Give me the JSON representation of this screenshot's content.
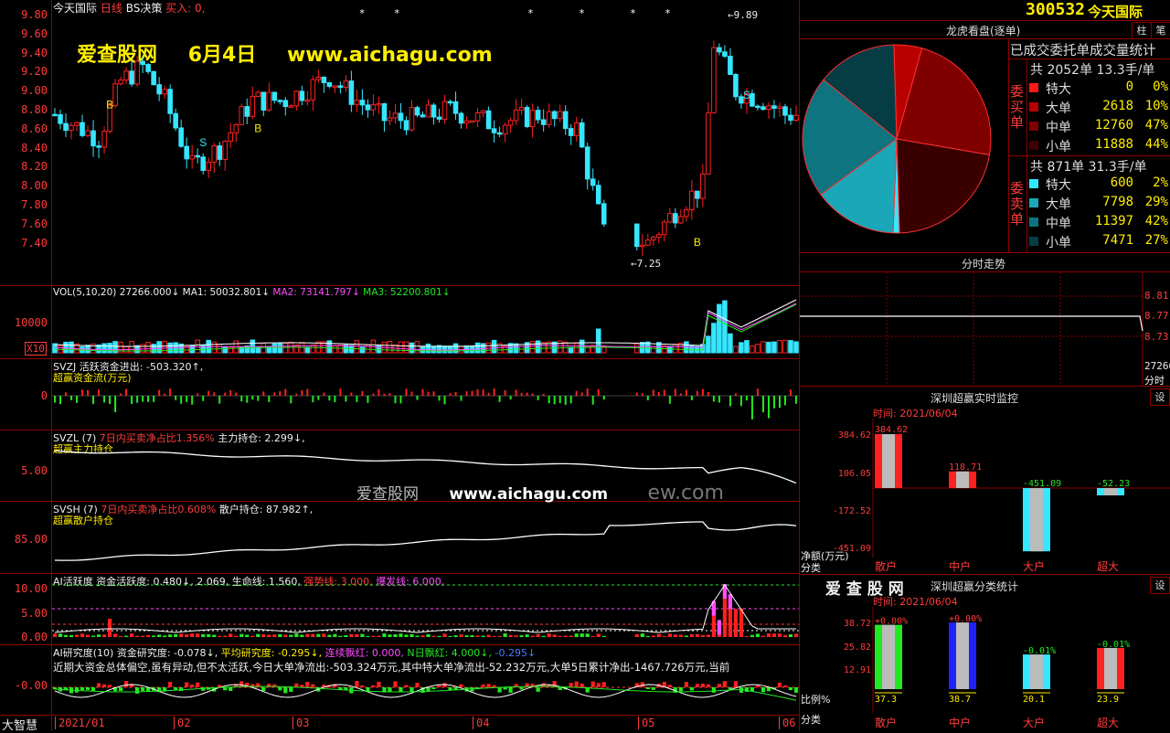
{
  "stock": {
    "code": "300532",
    "name": "今天国际",
    "period": "日线",
    "strategy": "BS决策",
    "buy_label": "买入: 0,"
  },
  "watermark": {
    "site": "爱查股网",
    "date": "6月4日",
    "url": "www.aichagu.com",
    "mid_site": "爱查股网",
    "mid_url": "www.aichagu.com",
    "mid_tail": "ew.com",
    "bottom_logo": "爱 查 股 网"
  },
  "price_axis": [
    "9.80",
    "9.60",
    "9.40",
    "9.20",
    "9.00",
    "8.80",
    "8.60",
    "8.40",
    "8.20",
    "8.00",
    "7.80",
    "7.60",
    "7.40"
  ],
  "price_marks": {
    "high": "9.89",
    "low": "7.25"
  },
  "bs_signals": {
    "b": "B",
    "s": "S"
  },
  "vol": {
    "header_name": "VOL(5,10,20)",
    "value": "27266.000↓",
    "ma1": "MA1: 50032.801↓",
    "ma2": "MA2: 73141.797↓",
    "ma3": "MA3: 52200.801↓",
    "axis": "10000",
    "x10": "X10"
  },
  "svzj": {
    "name": "SVZJ",
    "label": "活跃资金进出:",
    "value": "-503.320↑,",
    "sub": "超赢资金流(万元)",
    "axis": "0"
  },
  "svzl": {
    "name": "SVZL",
    "param": "(7)",
    "label": "7日内买卖净占比1.356%",
    "main_label": "主力持仓:",
    "main_value": "2.299↓,",
    "sub": "超赢主力持仓",
    "axis": "5.00"
  },
  "svsh": {
    "name": "SVSH",
    "param": "(7)",
    "label": "7日内买卖净占比0.608%",
    "main_label": "散户持仓:",
    "main_value": "87.982↑,",
    "sub": "超赢散户持仓",
    "axis": "85.00"
  },
  "ai_active": {
    "name": "AI活跃度",
    "a": "资金活跃度: 0.480↓,",
    "b": "2.069,",
    "c": "生命线: 1.560,",
    "d": "强势线: 3.000,",
    "e": "爆发线: 6.000,",
    "axis": [
      "10.00",
      "5.00",
      "0.00"
    ]
  },
  "ai_research": {
    "name": "AI研究度(10)",
    "a": "资金研究度: -0.078↓,",
    "b": "平均研究度: -0.295↓,",
    "c": "连续飘红: 0.000,",
    "d": "N日飘红: 4.000↓,",
    "e": "-0.295↓",
    "text": "近期大资金总体偏空,虽有异动,但不太活跃,今日大单净流出:-503.324万元,其中特大单净流出-52.232万元,大单5日累计净出-1467.726万元,当前",
    "axis": "-0.00"
  },
  "time_axis": [
    "2021/01",
    "02",
    "03",
    "04",
    "05",
    "06"
  ],
  "corner_label": "大智慧",
  "right": {
    "header_code": "300532",
    "header_name": "今天国际",
    "btn1": "柱",
    "btn2": "笔",
    "lhb_title": "龙虎看盘(逐单)",
    "stats_title": "已成交委托单成交量统计",
    "buy_total": "共 2052单 13.3手/单",
    "sell_total": "共 871单 31.3手/单",
    "buy_side": "委买单",
    "sell_side": "委卖单",
    "buy_rows": [
      {
        "label": "特大",
        "count": "0",
        "pct": "0%",
        "color": "#ff1a1a"
      },
      {
        "label": "大单",
        "count": "2618",
        "pct": "10%",
        "color": "#b80000"
      },
      {
        "label": "中单",
        "count": "12760",
        "pct": "47%",
        "color": "#800000"
      },
      {
        "label": "小单",
        "count": "11888",
        "pct": "44%",
        "color": "#400000"
      }
    ],
    "sell_rows": [
      {
        "label": "特大",
        "count": "600",
        "pct": "2%",
        "color": "#35e6ff"
      },
      {
        "label": "大单",
        "count": "7798",
        "pct": "29%",
        "color": "#1aa8b8"
      },
      {
        "label": "中单",
        "count": "11397",
        "pct": "42%",
        "color": "#0e7480"
      },
      {
        "label": "小单",
        "count": "7471",
        "pct": "27%",
        "color": "#063d44"
      }
    ],
    "intraday_title": "分时走势",
    "intraday_axis": [
      "8.81",
      "8.77",
      "8.73"
    ],
    "intraday_vol": [
      "27266",
      "分时"
    ],
    "monitor_title": "深圳超赢实时监控",
    "monitor_btn": "设",
    "monitor_time": "时间: 2021/06/04",
    "monitor_axis": [
      "384.62",
      "106.05",
      "-172.52",
      "-451.09"
    ],
    "monitor_unit": "净额(万元)",
    "monitor_cat": "分类",
    "monitor_bars": [
      {
        "cat": "散户",
        "value": 384.62,
        "label": "384.62",
        "color": "#ff2020"
      },
      {
        "cat": "中户",
        "value": 118.71,
        "label": "118.71",
        "color": "#ff2020"
      },
      {
        "cat": "大户",
        "value": -451.09,
        "label": "-451.09",
        "color": "#35e6ff"
      },
      {
        "cat": "超大",
        "value": -52.23,
        "label": "-52.23",
        "color": "#35e6ff"
      }
    ],
    "class_title": "深圳超赢分类统计",
    "class_btn": "设",
    "class_time": "时间: 2021/06/04",
    "class_axis": [
      "38.72",
      "25.82",
      "12.91"
    ],
    "class_unit": "比例%",
    "class_cat": "分类",
    "class_bars": [
      {
        "cat": "散户",
        "value": 37.3,
        "label": "37.3",
        "chg": "+0.00%",
        "color": "#22e822"
      },
      {
        "cat": "中户",
        "value": 38.7,
        "label": "38.7",
        "chg": "+0.00%",
        "color": "#2020ff"
      },
      {
        "cat": "大户",
        "value": 20.1,
        "label": "20.1",
        "chg": "-0.01%",
        "color": "#35e6ff"
      },
      {
        "cat": "超大",
        "value": 23.9,
        "label": "23.9",
        "chg": "-0.01%",
        "color": "#ff2020"
      }
    ]
  },
  "chart_data": {
    "type": "pie",
    "title": "已成交委托单成交量统计",
    "categories": [
      "委买特大",
      "委买大单",
      "委买中单",
      "委买小单",
      "委卖特大",
      "委卖大单",
      "委卖中单",
      "委卖小单"
    ],
    "values": [
      0,
      2618,
      12760,
      11888,
      600,
      7798,
      11397,
      7471
    ],
    "colors": [
      "#ff1a1a",
      "#b80000",
      "#800000",
      "#3a0000",
      "#35e6ff",
      "#1aa8b8",
      "#0e7480",
      "#063d44"
    ]
  }
}
